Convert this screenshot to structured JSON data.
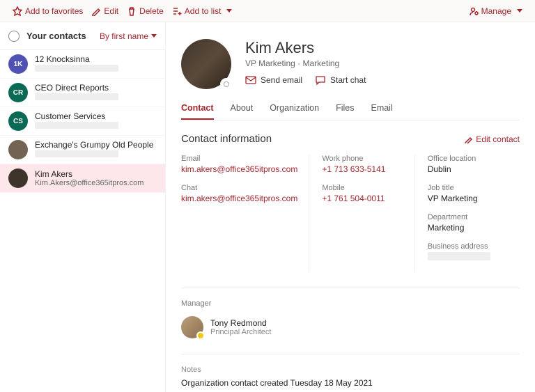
{
  "toolbar": {
    "add_favorites": "Add to favorites",
    "edit": "Edit",
    "delete": "Delete",
    "add_list": "Add to list",
    "manage": "Manage"
  },
  "sidebar": {
    "title": "Your contacts",
    "sort": "By first name",
    "items": [
      {
        "initials": "1K",
        "bg": "#4f52b2",
        "name": "12 Knocksinna",
        "sub": "",
        "sub_blurred": true,
        "photo": false,
        "selected": false
      },
      {
        "initials": "CR",
        "bg": "#0b6a56",
        "name": "CEO Direct Reports",
        "sub": "",
        "sub_blurred": true,
        "photo": false,
        "selected": false
      },
      {
        "initials": "CS",
        "bg": "#0b6a56",
        "name": "Customer Services",
        "sub": "",
        "sub_blurred": true,
        "photo": false,
        "selected": false
      },
      {
        "initials": "",
        "bg": "#736353",
        "name": "Exchange's Grumpy Old People",
        "sub": "",
        "sub_blurred": true,
        "photo": true,
        "selected": false
      },
      {
        "initials": "",
        "bg": "#3d342c",
        "name": "Kim Akers",
        "sub": "Kim.Akers@office365itpros.com",
        "sub_blurred": false,
        "photo": true,
        "selected": true
      }
    ]
  },
  "main": {
    "name": "Kim Akers",
    "title": "VP Marketing",
    "dept": "Marketing",
    "actions": {
      "send_email": "Send email",
      "start_chat": "Start chat"
    },
    "tabs": [
      "Contact",
      "About",
      "Organization",
      "Files",
      "Email"
    ],
    "active_tab": 0,
    "section_title": "Contact information",
    "edit_label": "Edit contact",
    "cols": [
      [
        {
          "label": "Email",
          "value": "kim.akers@office365itpros.com",
          "link": true
        },
        {
          "label": "Chat",
          "value": "kim.akers@office365itpros.com",
          "link": true
        }
      ],
      [
        {
          "label": "Work phone",
          "value": "+1 713 633-5141",
          "link": true
        },
        {
          "label": "Mobile",
          "value": "+1 761 504-0011",
          "link": true
        }
      ],
      [
        {
          "label": "Office location",
          "value": "Dublin",
          "link": false
        },
        {
          "label": "Job title",
          "value": "VP Marketing",
          "link": false
        },
        {
          "label": "Department",
          "value": "Marketing",
          "link": false
        },
        {
          "label": "Business address",
          "value": "",
          "blurred": true
        }
      ]
    ],
    "manager": {
      "label": "Manager",
      "name": "Tony Redmond",
      "title": "Principal Architect"
    },
    "notes": {
      "label": "Notes",
      "text": "Organization contact created Tuesday 18 May 2021"
    }
  }
}
